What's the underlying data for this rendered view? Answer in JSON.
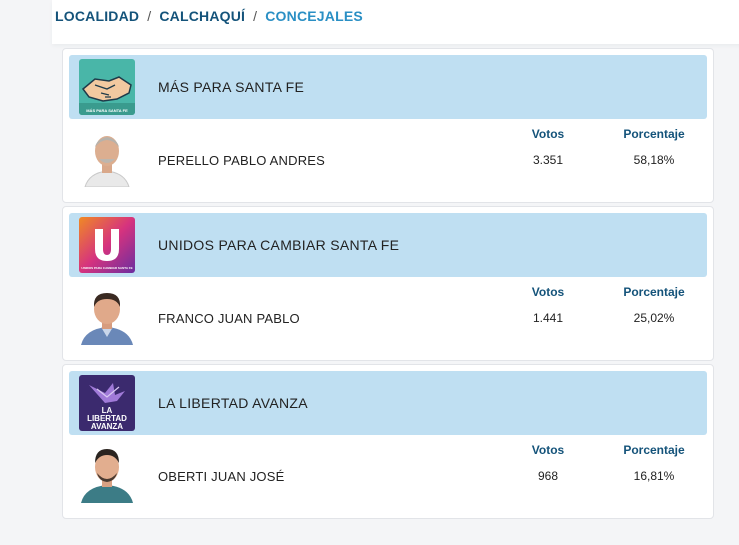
{
  "breadcrumb": {
    "items": [
      "LOCALIDAD",
      "CALCHAQUÍ",
      "CONCEJALES"
    ],
    "separator": "/"
  },
  "columns": {
    "votes_label": "Votos",
    "percent_label": "Porcentaje"
  },
  "results": [
    {
      "party": "MÁS PARA SANTA FE",
      "logo_text": "MÁS PARA SANTA FE",
      "candidate": "PERELLO PABLO ANDRES",
      "votes": "3.351",
      "percent": "58,18%"
    },
    {
      "party": "UNIDOS PARA CAMBIAR SANTA FE",
      "logo_text": "UNIDOS PARA CAMBIAR SANTA FE",
      "candidate": "FRANCO JUAN PABLO",
      "votes": "1.441",
      "percent": "25,02%"
    },
    {
      "party": "LA LIBERTAD AVANZA",
      "logo_text": "LA LIBERTAD AVANZA",
      "candidate": "OBERTI JUAN JOSÉ",
      "votes": "968",
      "percent": "16,81%"
    }
  ],
  "colors": {
    "accent_dark": "#14537a",
    "accent_light": "#2a8fc4",
    "party_band": "#bfdff2"
  }
}
